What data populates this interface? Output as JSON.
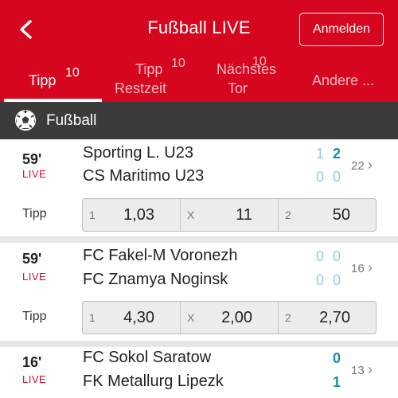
{
  "header": {
    "title": "Fußball LIVE",
    "login_label": "Anmelden",
    "back_icon": "chevron-left-icon",
    "bg_color": "#d7061f"
  },
  "tabs": [
    {
      "label": "Tipp",
      "count": "10",
      "active": true
    },
    {
      "label": "Tipp Restzeit",
      "line1": "Tipp",
      "line2": "Restzeit",
      "count": "10"
    },
    {
      "label": "Nächstes Tor",
      "line1": "Nächstes",
      "line2": "Tor",
      "count": "10"
    },
    {
      "label": "Andere ..."
    }
  ],
  "section": {
    "title": "Fußball",
    "icon": "soccer-ball-icon"
  },
  "matches": [
    {
      "minute": "59'",
      "status": "LIVE",
      "home": {
        "name": "Sporting L. U23",
        "score_a": "1",
        "score_b": "2"
      },
      "away": {
        "name": "CS Maritimo U23",
        "score_a": "0",
        "score_b": "0"
      },
      "more_count": "22",
      "tipp_label": "Tipp",
      "odds": [
        {
          "key": "1",
          "value": "1,03"
        },
        {
          "key": "X",
          "value": "11"
        },
        {
          "key": "2",
          "value": "50"
        }
      ]
    },
    {
      "minute": "59'",
      "status": "LIVE",
      "home": {
        "name": "FC Fakel-M Voronezh",
        "score_a": "0",
        "score_b": "0"
      },
      "away": {
        "name": "FC Znamya Noginsk",
        "score_a": "0",
        "score_b": "0"
      },
      "more_count": "16",
      "tipp_label": "Tipp",
      "odds": [
        {
          "key": "1",
          "value": "4,30"
        },
        {
          "key": "X",
          "value": "2,00"
        },
        {
          "key": "2",
          "value": "2,70"
        }
      ]
    },
    {
      "minute": "16'",
      "status": "LIVE",
      "home": {
        "name": "FC Sokol Saratow",
        "score_b": "0"
      },
      "away": {
        "name": "FK Metallurg Lipezk",
        "score_b": "1"
      },
      "more_count": "13"
    }
  ]
}
